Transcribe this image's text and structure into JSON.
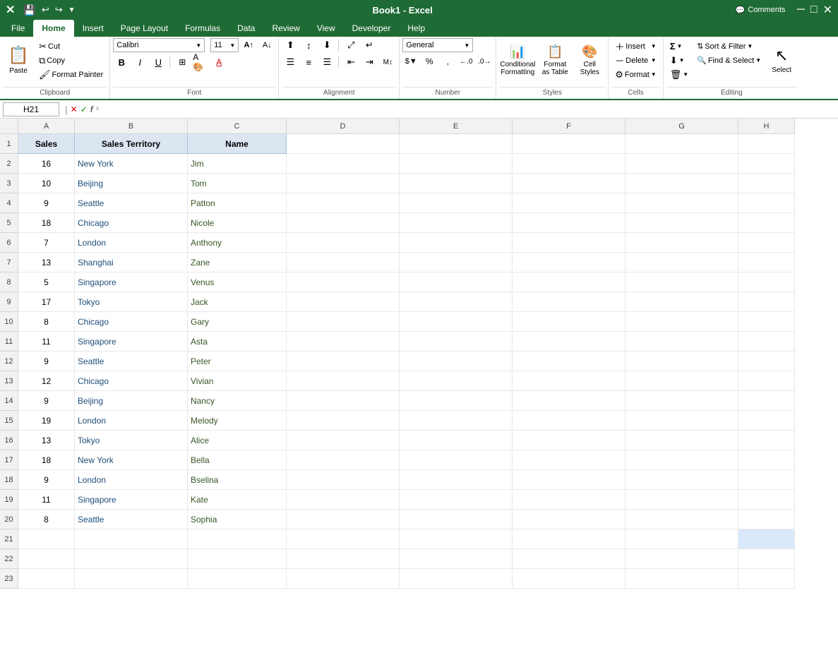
{
  "app": {
    "title": "Book1 - Excel",
    "comments_label": "Comments"
  },
  "tabs": [
    {
      "id": "file",
      "label": "File"
    },
    {
      "id": "home",
      "label": "Home",
      "active": true
    },
    {
      "id": "insert",
      "label": "Insert"
    },
    {
      "id": "page_layout",
      "label": "Page Layout"
    },
    {
      "id": "formulas",
      "label": "Formulas"
    },
    {
      "id": "data",
      "label": "Data"
    },
    {
      "id": "review",
      "label": "Review"
    },
    {
      "id": "view",
      "label": "View"
    },
    {
      "id": "developer",
      "label": "Developer"
    },
    {
      "id": "help",
      "label": "Help"
    }
  ],
  "ribbon": {
    "groups": {
      "clipboard": {
        "label": "Clipboard",
        "paste_label": "Paste",
        "cut_label": "Cut",
        "copy_label": "Copy",
        "format_painter_label": "Format Painter"
      },
      "font": {
        "label": "Font",
        "font_name": "Calibri",
        "font_size": "11",
        "bold": "B",
        "italic": "I",
        "underline": "U"
      },
      "alignment": {
        "label": "Alignment",
        "wrap_text": "Wrap Text",
        "merge_center": "Merge & Center"
      },
      "number": {
        "label": "Number",
        "format": "General"
      },
      "styles": {
        "label": "Styles",
        "conditional_formatting": "Conditional Formatting",
        "format_as_table": "Format as Table",
        "cell_styles": "Cell Styles"
      },
      "cells": {
        "label": "Cells",
        "insert": "Insert",
        "delete": "Delete",
        "format": "Format"
      },
      "editing": {
        "label": "Editing",
        "sum": "Σ",
        "fill": "Fill",
        "clear": "Clear",
        "sort_filter": "Sort & Filter",
        "find_select": "Find & Select",
        "select": "Select"
      }
    }
  },
  "formula_bar": {
    "name_box": "H21",
    "formula": ""
  },
  "sheet": {
    "columns": [
      "A",
      "B",
      "C",
      "D",
      "E",
      "F",
      "G",
      "H"
    ],
    "header_row": {
      "a": "Sales",
      "b": "Sales Territory",
      "c": "Name"
    },
    "rows": [
      {
        "num": 1,
        "a": "Sales",
        "b": "Sales Territory",
        "c": "Name",
        "is_header": true
      },
      {
        "num": 2,
        "a": "16",
        "b": "New York",
        "c": "Jim"
      },
      {
        "num": 3,
        "a": "10",
        "b": "Beijing",
        "c": "Tom"
      },
      {
        "num": 4,
        "a": "9",
        "b": "Seattle",
        "c": "Patton"
      },
      {
        "num": 5,
        "a": "18",
        "b": "Chicago",
        "c": "Nicole"
      },
      {
        "num": 6,
        "a": "7",
        "b": "London",
        "c": "Anthony"
      },
      {
        "num": 7,
        "a": "13",
        "b": "Shanghai",
        "c": "Zane"
      },
      {
        "num": 8,
        "a": "5",
        "b": "Singapore",
        "c": "Venus"
      },
      {
        "num": 9,
        "a": "17",
        "b": "Tokyo",
        "c": "Jack"
      },
      {
        "num": 10,
        "a": "8",
        "b": "Chicago",
        "c": "Gary"
      },
      {
        "num": 11,
        "a": "11",
        "b": "Singapore",
        "c": "Asta"
      },
      {
        "num": 12,
        "a": "9",
        "b": "Seattle",
        "c": "Peter"
      },
      {
        "num": 13,
        "a": "12",
        "b": "Chicago",
        "c": "Vivian"
      },
      {
        "num": 14,
        "a": "9",
        "b": "Beijing",
        "c": "Nancy"
      },
      {
        "num": 15,
        "a": "19",
        "b": "London",
        "c": "Melody"
      },
      {
        "num": 16,
        "a": "13",
        "b": "Tokyo",
        "c": "Alice"
      },
      {
        "num": 17,
        "a": "18",
        "b": "New York",
        "c": "Bella"
      },
      {
        "num": 18,
        "a": "9",
        "b": "London",
        "c": "Bselina"
      },
      {
        "num": 19,
        "a": "11",
        "b": "Singapore",
        "c": "Kate"
      },
      {
        "num": 20,
        "a": "8",
        "b": "Seattle",
        "c": "Sophia"
      },
      {
        "num": 21,
        "a": "",
        "b": "",
        "c": ""
      },
      {
        "num": 22,
        "a": "",
        "b": "",
        "c": ""
      },
      {
        "num": 23,
        "a": "",
        "b": "",
        "c": ""
      }
    ]
  }
}
